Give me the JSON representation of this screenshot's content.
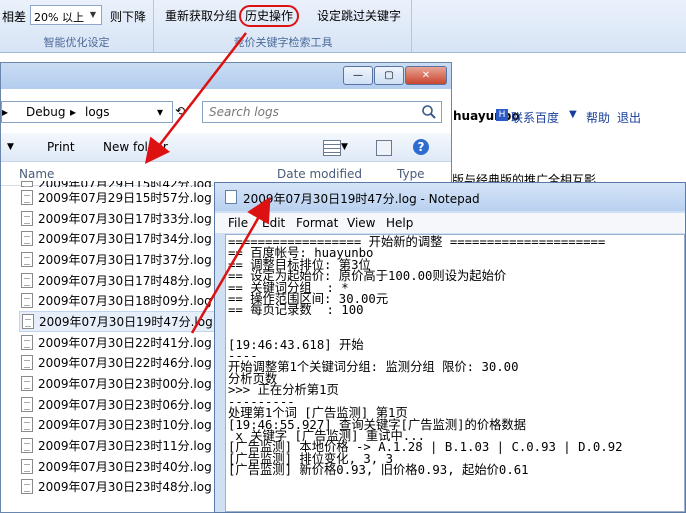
{
  "ribbon": {
    "diff_label": "相差",
    "pct_value": "20% 以上",
    "then_down": "则下降",
    "group1_caption": "智能优化设定",
    "btn_refetch": "重新获取分组",
    "btn_history": "历史操作",
    "btn_skip": "设定跳过关键字",
    "group2_caption": "竞价关键字检索工具"
  },
  "explorer": {
    "address": [
      "Debug",
      "logs"
    ],
    "search_placeholder": "Search logs",
    "toolbar": {
      "print": "Print",
      "new_folder": "New folder"
    },
    "columns": {
      "name": "Name",
      "date": "Date modified",
      "type": "Type"
    },
    "files": [
      "2009年07月29日15时57分.log",
      "2009年07月30日17时33分.log",
      "2009年07月30日17时34分.log",
      "2009年07月30日17时37分.log",
      "2009年07月30日17时48分.log",
      "2009年07月30日18时09分.log",
      "2009年07月30日19时47分.log",
      "2009年07月30日22时41分.log",
      "2009年07月30日22时46分.log",
      "2009年07月30日23时00分.log",
      "2009年07月30日23时06分.log",
      "2009年07月30日23时10分.log",
      "2009年07月30日23时11分.log",
      "2009年07月30日23时40分.log",
      "2009年07月30日23时48分.log"
    ],
    "partial_top_file": "2009年07月29日15时42分.log"
  },
  "bgpage": {
    "user": "huayunbo",
    "contact": "联系百度",
    "help": "帮助",
    "logout": "退出",
    "promo": "版与经典版的推广全相互影"
  },
  "notepad": {
    "title": "2009年07月30日19时47分.log - Notepad",
    "menu": [
      "File",
      "Edit",
      "Format",
      "View",
      "Help"
    ],
    "content": "================== 开始新的调整 =====================\n== 百度帐号: huayunbo\n== 调整目标排位: 第3位\n== 设定为起始价: 原价高于100.00则设为起始价\n== 关键词分组  : *\n== 操作范围区间: 30.00元\n== 每页记录数  : 100\n\n\n[19:46:43.618] 开始\n----\n开始调整第1个关键词分组: 监测分组 限价: 30.00\n分析页数\n>>> 正在分析第1页\n---------\n处理第1个词 [广告监测] 第1页\n[19:46:55.927] 查询关键字[广告监测]的价格数据\n x 关键字 [广告监测] 重试中...\n[广告监测] 本地价格 -> A.1.28 | B.1.03 | C.0.93 | D.0.92\n[广告监测] 排位变化, 3, 3\n[广告监测] 新价格0.93, 旧价格0.93, 起始价0.61"
  }
}
